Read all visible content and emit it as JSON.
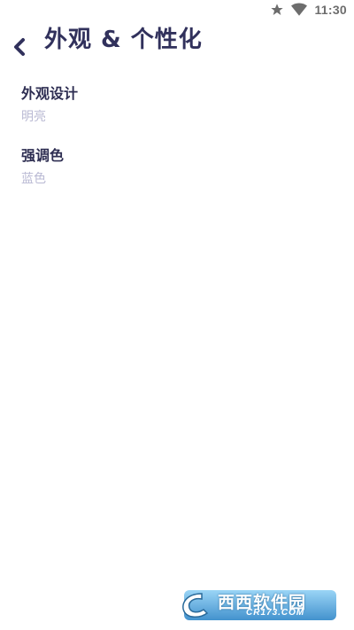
{
  "status_bar": {
    "time": "11:30",
    "icons": [
      "star-icon",
      "wifi-icon"
    ]
  },
  "header": {
    "back_icon": "chevron-left-icon",
    "title": "外观 & 个性化"
  },
  "settings": [
    {
      "title": "外观设计",
      "value": "明亮"
    },
    {
      "title": "强调色",
      "value": "蓝色"
    }
  ],
  "colors": {
    "title": "#31315c",
    "item_title": "#2e2e52",
    "item_value": "#b9b9d3",
    "background": "#ffffff"
  },
  "watermark": {
    "text": "西西软件园",
    "url": "CR173.COM"
  }
}
